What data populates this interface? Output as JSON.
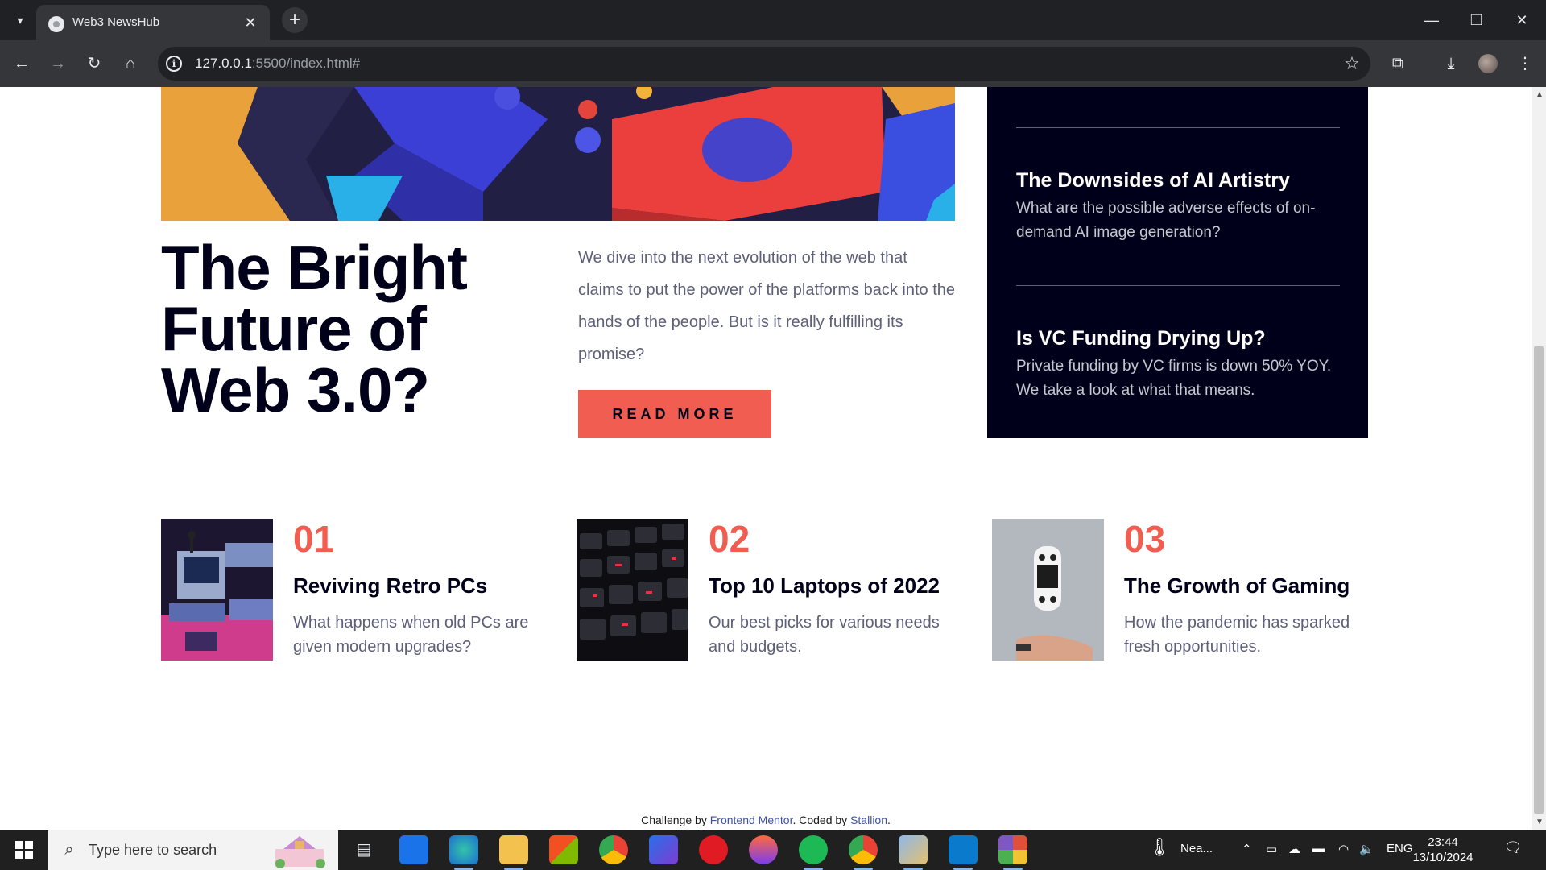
{
  "browser": {
    "tab_title": "Web3 NewsHub",
    "url_host": "127.0.0.1",
    "url_rest": ":5500/index.html#",
    "tab_close": "✕",
    "new_tab": "+"
  },
  "hero": {
    "title": "The Bright Future of Web 3.0?",
    "description": "We dive into the next evolution of the web that claims to put the power of the platforms back into the hands of the people. But is it really fulfilling its promise?",
    "button_label": "READ MORE"
  },
  "new_panel": {
    "items": [
      {
        "title": "The Downsides of AI Artistry",
        "description": "What are the possible adverse effects of on-demand AI image generation?"
      },
      {
        "title": "Is VC Funding Drying Up?",
        "description": "Private funding by VC firms is down 50% YOY. We take a look at what that means."
      }
    ]
  },
  "cards": [
    {
      "number": "01",
      "title": "Reviving Retro PCs",
      "description": "What happens when old PCs are given modern upgrades?"
    },
    {
      "number": "02",
      "title": "Top 10 Laptops of 2022",
      "description": "Our best picks for various needs and budgets."
    },
    {
      "number": "03",
      "title": "The Growth of Gaming",
      "description": "How the pandemic has sparked fresh opportunities."
    }
  ],
  "attribution": {
    "prefix": "Challenge by ",
    "link1": "Frontend Mentor",
    "middle": ". Coded by ",
    "link2": "Stallion",
    "suffix": "."
  },
  "taskbar": {
    "search_placeholder": "Type here to search",
    "weather": "Nea...",
    "language": "ENG",
    "time": "23:44",
    "date": "13/10/2024"
  }
}
